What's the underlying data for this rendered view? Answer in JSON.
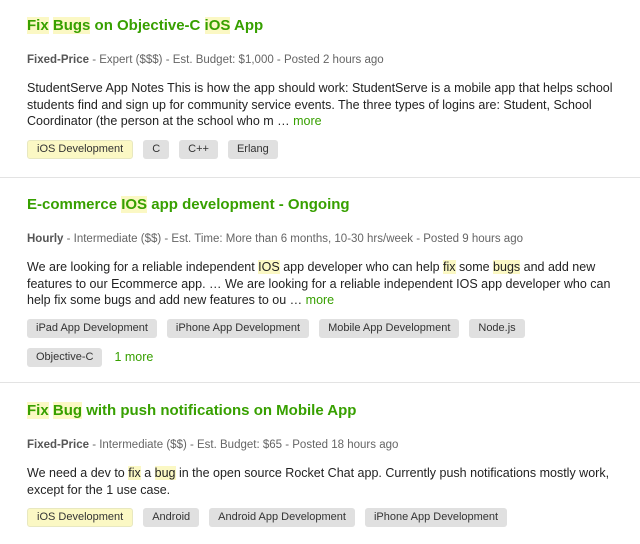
{
  "jobs": [
    {
      "title": [
        "Fix",
        " ",
        "Bugs",
        " on Objective-C ",
        "iOS",
        " App"
      ],
      "type": "Fixed-Price",
      "meta_rest": " - Expert ($$$) - Est. Budget: $1,000 - Posted 2 hours ago",
      "description": "StudentServe App Notes This is how the app should work: StudentServe is a mobile app that helps school students find and sign up for community service events. The three types of logins are: Student, School Coordinator (the person at the school who m … ",
      "more_label": "more",
      "tags": [
        "iOS Development",
        "C",
        "C++",
        "Erlang"
      ]
    },
    {
      "title_pre": "E-commerce ",
      "title_hl": "IOS",
      "title_post": " app development - Ongoing",
      "type": "Hourly",
      "meta_rest": " - Intermediate ($$) - Est. Time: More than 6 months, 10-30 hrs/week - Posted 9 hours ago",
      "desc_parts": [
        "We are looking for a reliable independent ",
        "IOS",
        " app developer who can help ",
        "fix",
        " some ",
        "bugs",
        " and add new features to our Ecommerce app. … We are looking for a reliable independent IOS app developer who can help fix some bugs and add new features to ou … "
      ],
      "more_label": "more",
      "tags": [
        "iPad App Development",
        "iPhone App Development",
        "Mobile App Development",
        "Node.js",
        "Objective-C"
      ],
      "more_tags_label": "1 more"
    },
    {
      "title": [
        "Fix",
        " ",
        "Bug",
        " with push notifications on Mobile App"
      ],
      "type": "Fixed-Price",
      "meta_rest": " - Intermediate ($$) - Est. Budget: $65 - Posted 18 hours ago",
      "desc_parts": [
        "We need a dev to ",
        "fix",
        " a ",
        "bug",
        " in the open source Rocket Chat app. Currently push notifications mostly work, except for the 1 use case."
      ],
      "tags": [
        "iOS Development",
        "Android",
        "Android App Development",
        "iPhone App Development"
      ]
    }
  ],
  "colors": {
    "link_green": "#37a000",
    "highlight": "#fbf8c4",
    "tag_bg": "#e0e0e0"
  }
}
